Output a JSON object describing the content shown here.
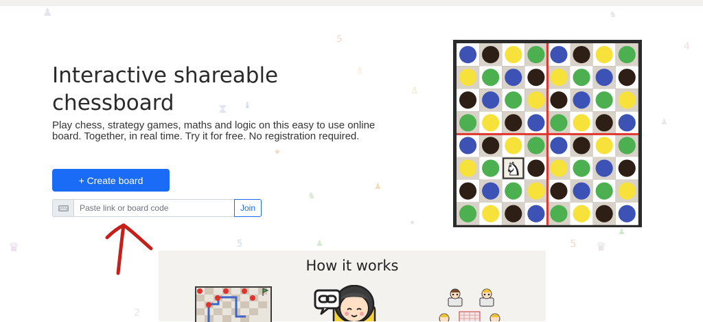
{
  "hero": {
    "title": "Interactive shareable chessboard",
    "description": "Play chess, strategy games, maths and logic on this easy to use online board. Together, in real time. Try it for free. No registration required."
  },
  "actions": {
    "create_board_label": "+ Create board",
    "code_input": {
      "placeholder": "Paste link or board code",
      "value": ""
    },
    "join_label": "Join",
    "keyboard_icon": "keyboard-icon"
  },
  "board_preview": {
    "piece": "white-knight",
    "colors": {
      "blue": "#3d52b5",
      "dark": "#2e1f16",
      "yellow": "#f7e13b",
      "green": "#4caf50",
      "red_line": "#e0332e",
      "light_square": "#ffffff",
      "dark_square": "#d9d2c8"
    },
    "rows": [
      [
        "blue",
        "dark",
        "yellow",
        "green",
        "blue",
        "dark",
        "yellow",
        "green"
      ],
      [
        "yellow",
        "green",
        "blue",
        "dark",
        "yellow",
        "green",
        "blue",
        "dark"
      ],
      [
        "dark",
        "blue",
        "green",
        "yellow",
        "dark",
        "blue",
        "green",
        "yellow"
      ],
      [
        "green",
        "yellow",
        "dark",
        "blue",
        "green",
        "yellow",
        "dark",
        "blue"
      ],
      [
        "blue",
        "dark",
        "yellow",
        "green",
        "blue",
        "dark",
        "yellow",
        "green"
      ],
      [
        "yellow",
        "green",
        "knight",
        "dark",
        "yellow",
        "green",
        "blue",
        "dark"
      ],
      [
        "dark",
        "blue",
        "green",
        "yellow",
        "dark",
        "blue",
        "green",
        "yellow"
      ],
      [
        "green",
        "yellow",
        "dark",
        "blue",
        "green",
        "yellow",
        "dark",
        "blue"
      ]
    ]
  },
  "how_it_works": {
    "title": "How it works",
    "illustrations": [
      "maze-board-illustration",
      "person-with-link-illustration",
      "players-around-board-illustration"
    ]
  },
  "annotation": {
    "icon": "red-arrow-icon"
  }
}
